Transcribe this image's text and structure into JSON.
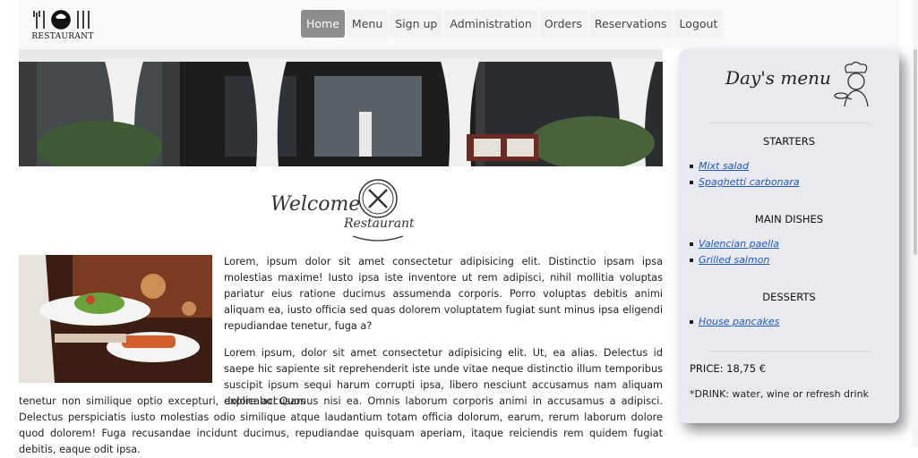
{
  "brand": {
    "logo_text": "RESTAURANT"
  },
  "nav": {
    "items": [
      "Home",
      "Menu",
      "Sign up",
      "Administration",
      "Orders",
      "Reservations",
      "Logout"
    ],
    "active": "Home"
  },
  "welcome": {
    "text": "Welcome",
    "badge_text": "Restaurant"
  },
  "content": {
    "paragraph1": "Lorem, ipsum dolor sit amet consectetur adipisicing elit. Distinctio ipsam ipsa molestias maxime! Iusto ipsa iste inventore ut rem adipisci, nihil mollitia voluptas pariatur eius ratione ducimus assumenda corporis. Porro voluptas debitis animi aliquam ea, iusto officia sed quas dolorem voluptatem fugiat sunt minus ipsa eligendi repudiandae tenetur, fuga a?",
    "paragraph2_a": "Lorem ipsum, dolor sit amet consectetur adipisicing elit. Ut, ea alias. Delectus id saepe hic sapiente sit reprehenderit iste unde vitae neque distinctio illum temporibus suscipit ipsum sequi harum corrupti ipsa, libero nesciunt accusamus nam aliquam explicabo! Quos",
    "paragraph2_b": "tenetur non similique optio excepturi, dolore accusamus nisi ea. Omnis laborum corporis animi in accusamus a adipisci. Delectus perspiciatis iusto molestias odio similique atque laudantium totam officia dolorum, earum, rerum laborum dolore quod dolorem! Fuga recusandae incidunt ducimus, repudiandae quisquam aperiam, itaque reiciendis rem quidem fugiat debitis, eaque odit ipsa."
  },
  "day_menu": {
    "title": "Day's menu",
    "sections": {
      "starters": {
        "label": "STARTERS",
        "items": [
          "Mixt salad",
          "Spaghetti carbonara"
        ]
      },
      "mains": {
        "label": "MAIN DISHES",
        "items": [
          "Valencian paella",
          "Grilled salmon"
        ]
      },
      "desserts": {
        "label": "DESSERTS",
        "items": [
          "House pancakes"
        ]
      }
    },
    "price": "PRICE: 18,75 €",
    "drink": "*DRINK: water, wine or refresh drink"
  },
  "colors": {
    "active_nav": "#8d8d8d",
    "link": "#1f57c3",
    "card_bg": "#e8eaf0",
    "topbar_bg": "#f8f9fa"
  }
}
